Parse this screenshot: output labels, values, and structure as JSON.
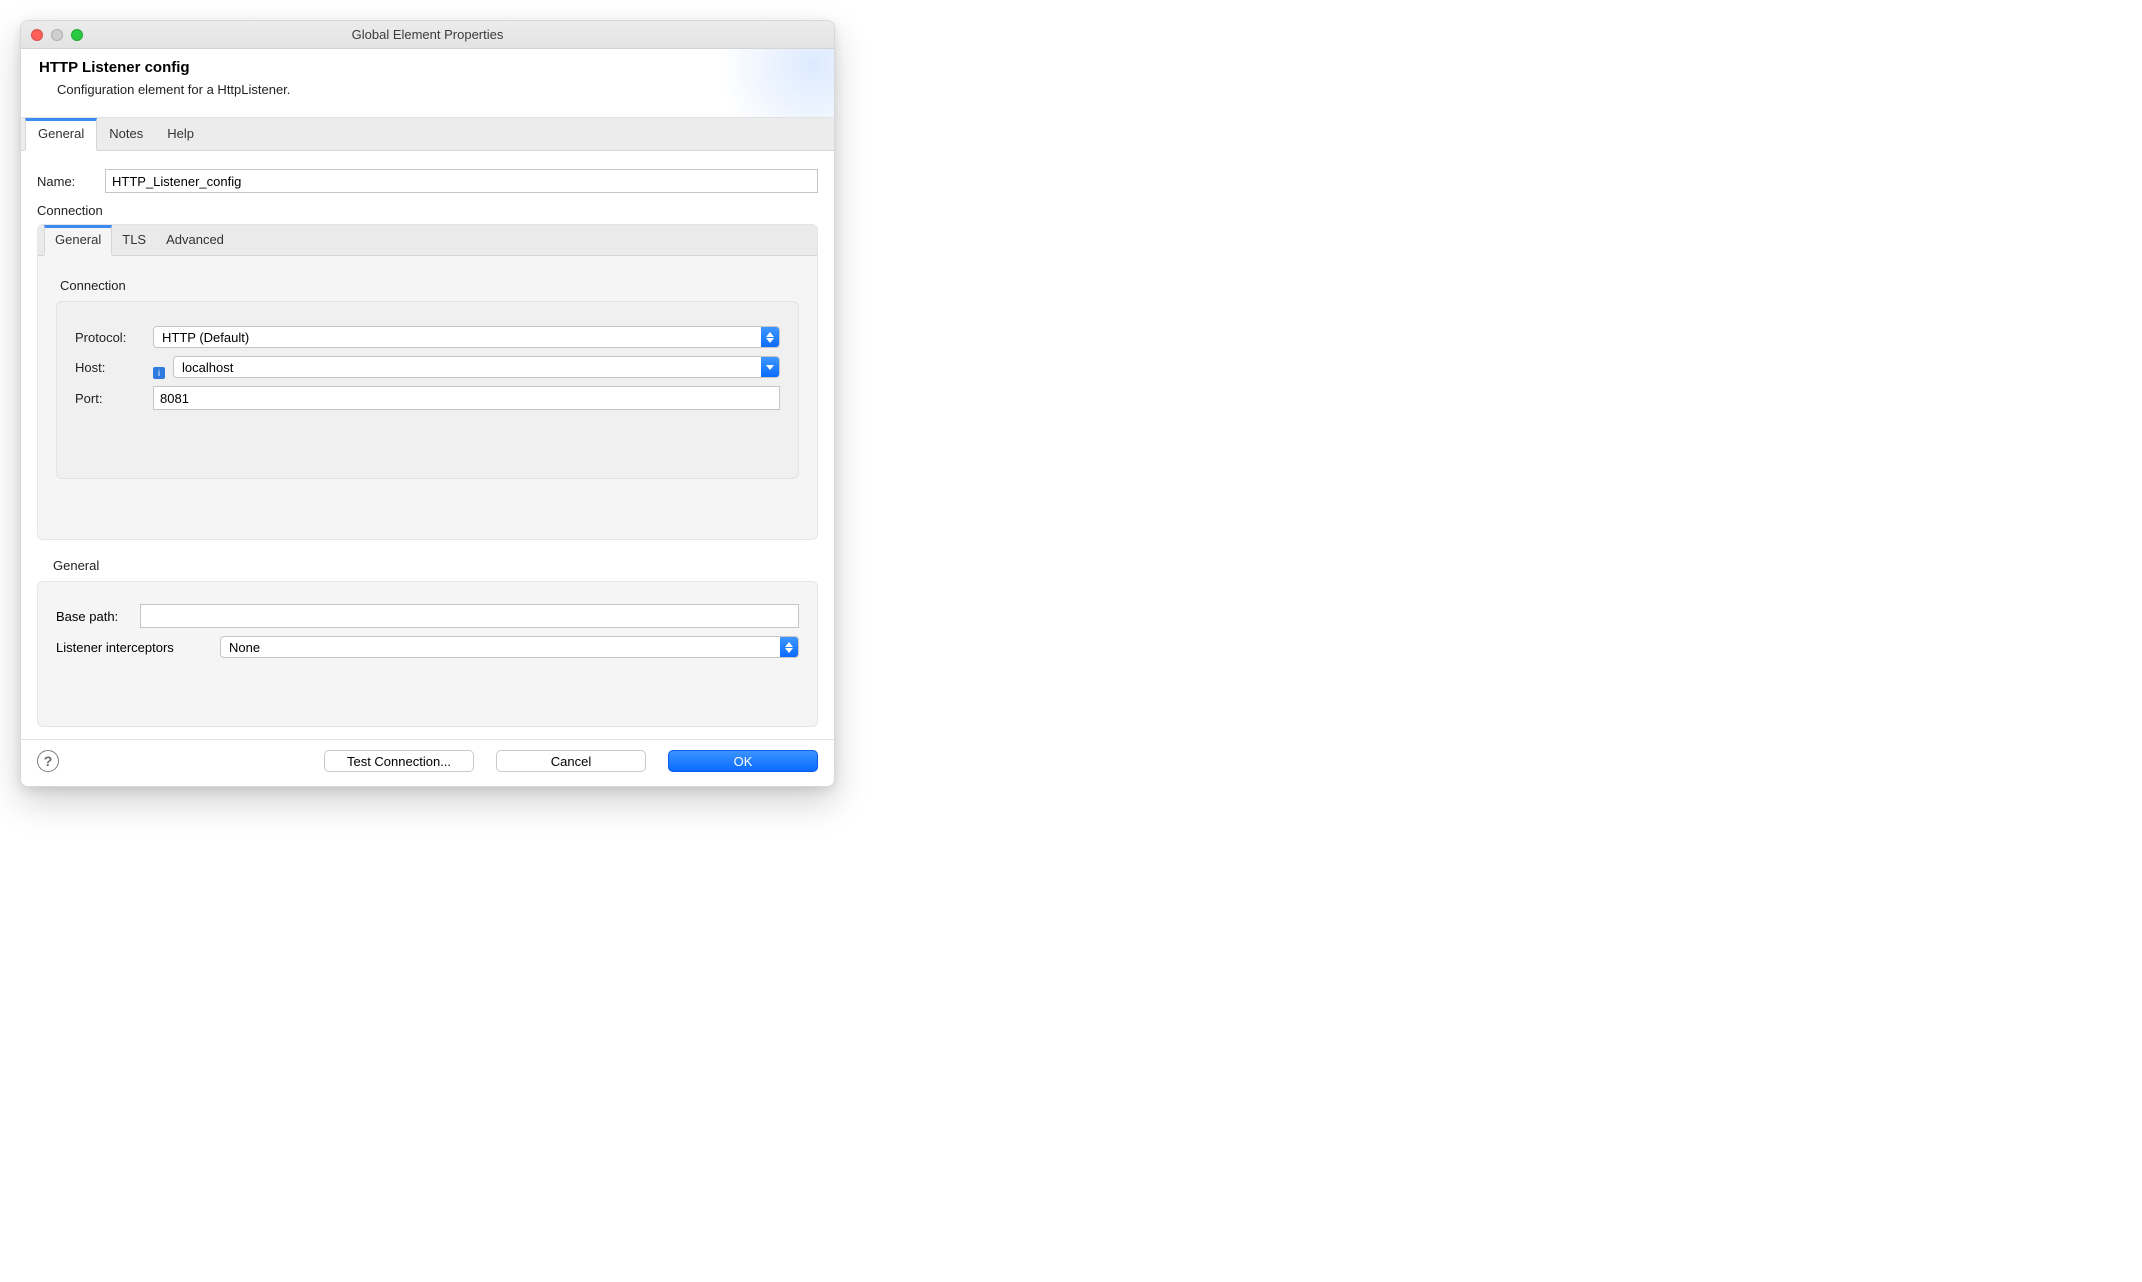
{
  "window": {
    "title": "Global Element Properties"
  },
  "header": {
    "title": "HTTP Listener config",
    "subtitle": "Configuration element for a HttpListener."
  },
  "tabs": {
    "main": [
      {
        "label": "General",
        "active": true
      },
      {
        "label": "Notes",
        "active": false
      },
      {
        "label": "Help",
        "active": false
      }
    ],
    "connection": [
      {
        "label": "General",
        "active": true
      },
      {
        "label": "TLS",
        "active": false
      },
      {
        "label": "Advanced",
        "active": false
      }
    ]
  },
  "form": {
    "name_label": "Name:",
    "name_value": "HTTP_Listener_config",
    "connection_section": "Connection",
    "inner_connection_section": "Connection",
    "protocol_label": "Protocol:",
    "protocol_value": "HTTP (Default)",
    "host_label": "Host:",
    "host_value": "localhost",
    "port_label": "Port:",
    "port_value": "8081",
    "general_section": "General",
    "basepath_label": "Base path:",
    "basepath_value": "",
    "interceptors_label": "Listener interceptors",
    "interceptors_value": "None"
  },
  "footer": {
    "test_label": "Test Connection...",
    "cancel_label": "Cancel",
    "ok_label": "OK"
  },
  "icons": {
    "help_glyph": "?",
    "info_glyph": "i"
  }
}
